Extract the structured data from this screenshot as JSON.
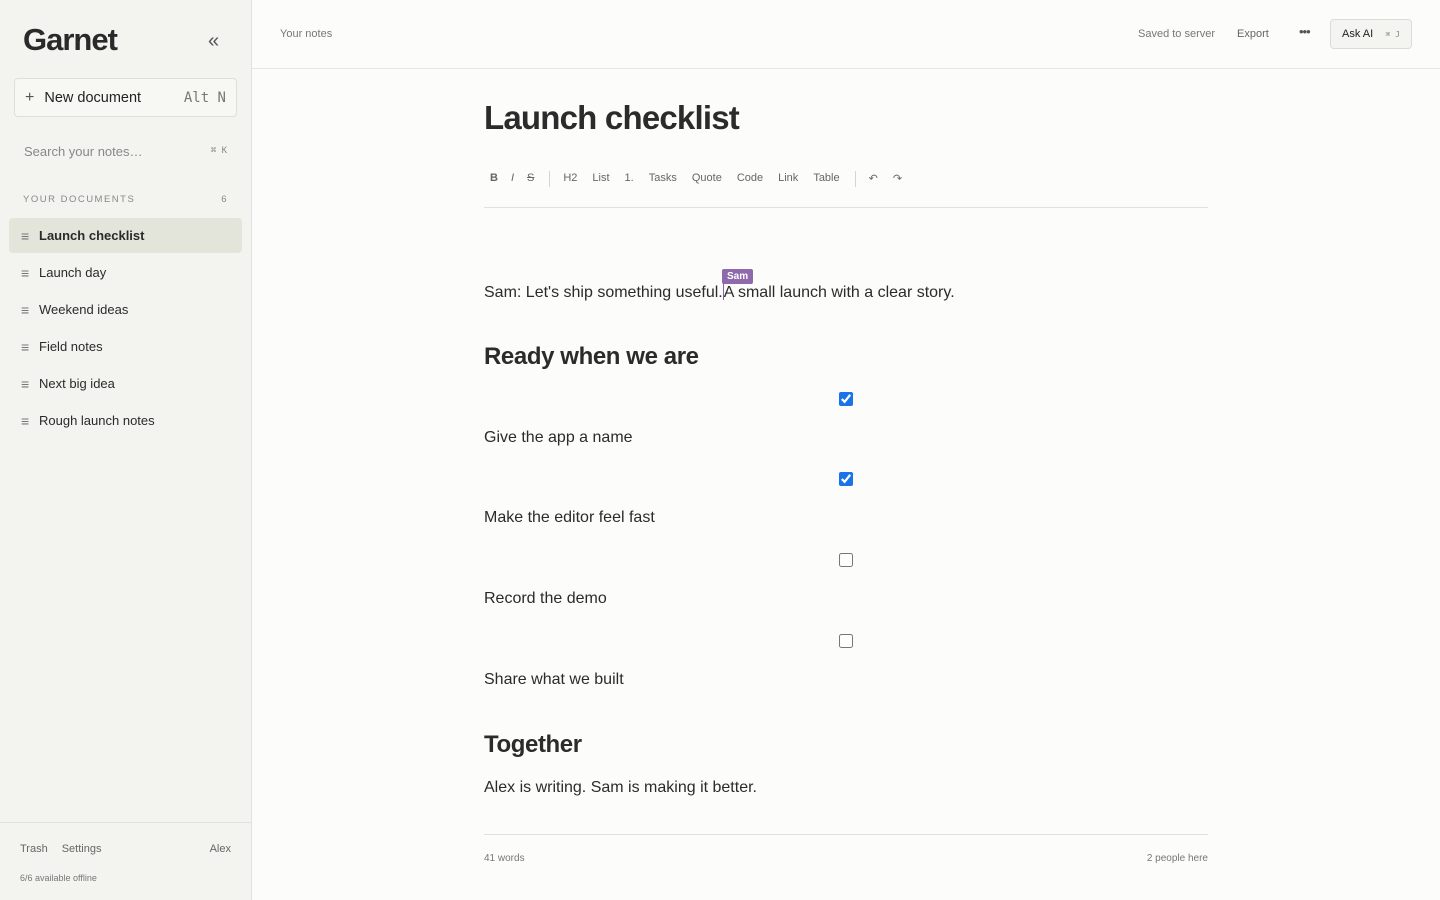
{
  "app": {
    "brand": "Garnet",
    "collapse_glyph": "«"
  },
  "sidebar": {
    "new_document_label": "New document",
    "new_document_shortcut": "Alt N",
    "search_placeholder": "Search your notes…",
    "search_shortcut": "⌘ K",
    "section_title": "YOUR DOCUMENTS",
    "document_count": "6",
    "documents": [
      {
        "title": "Launch checklist",
        "active": true
      },
      {
        "title": "Launch day",
        "active": false
      },
      {
        "title": "Weekend ideas",
        "active": false
      },
      {
        "title": "Field notes",
        "active": false
      },
      {
        "title": "Next big idea",
        "active": false
      },
      {
        "title": "Rough launch notes",
        "active": false
      }
    ],
    "footer": {
      "trash": "Trash",
      "settings": "Settings",
      "user": "Alex",
      "offline_status": "6/6 available offline"
    }
  },
  "topbar": {
    "breadcrumb": "Your notes",
    "save_status": "Saved to server",
    "export_label": "Export",
    "more_glyph": "•••",
    "ask_ai_label": "Ask AI",
    "ask_ai_shortcut": "⌘ J"
  },
  "editor": {
    "title": "Launch checklist",
    "toolbar": {
      "bold": "B",
      "italic": "I",
      "strike": "S",
      "h2": "H2",
      "list": "List",
      "ordered": "1.",
      "tasks": "Tasks",
      "quote": "Quote",
      "code": "Code",
      "link": "Link",
      "table": "Table",
      "undo": "↶",
      "redo": "↷"
    },
    "intro_before_caret": "Sam: Let's ship something useful.",
    "intro_after_caret": "A small launch with a clear story.",
    "collaborator_cursor": {
      "name": "Sam",
      "color": "#8e6aac"
    },
    "heading_1": "Ready when we are",
    "tasks": [
      {
        "text": "Give the app a name",
        "done": true
      },
      {
        "text": "Make the editor feel fast",
        "done": true
      },
      {
        "text": "Record the demo",
        "done": false
      },
      {
        "text": "Share what we built",
        "done": false
      }
    ],
    "heading_2": "Together",
    "closing": "Alex is writing. Sam is making it better.",
    "word_count": "41 words",
    "presence": "2 people here"
  },
  "colors": {
    "sidebar_bg": "#f3f3ef",
    "page_bg": "#fcfcfa",
    "active_doc_bg": "#e3e5db",
    "collaborator": "#8e6aac",
    "checkbox_accent": "#1a73e8"
  }
}
